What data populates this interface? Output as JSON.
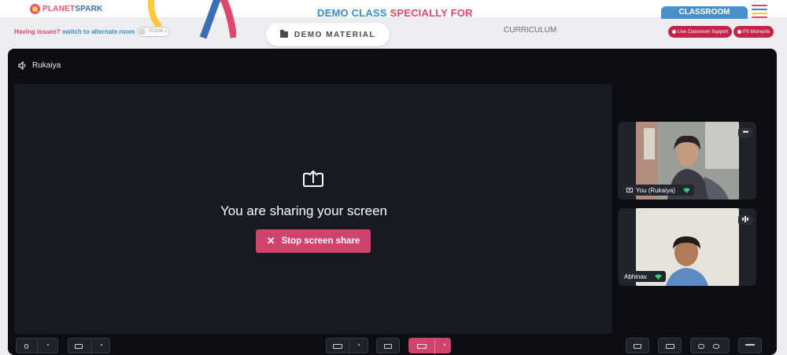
{
  "header": {
    "logo": {
      "text_a": "PLANET",
      "text_b": "SPARK"
    },
    "title_part1": "DEMO CLASS ",
    "title_part2": "SPECIALLY FOR",
    "classroom_tab": "CLASSROOM",
    "hamburger_colors": [
      "#e0476a",
      "#3a8ec8",
      "#ffc93c",
      "#e0476a"
    ]
  },
  "subbar": {
    "issues_label": "Having issues?",
    "alternate_room": "switch to alternate room",
    "room_toggle": "ROOM 1",
    "demo_material": "DEMO MATERIAL",
    "curriculum": "CURRICULUM",
    "live_support": "Live Classroom Support",
    "ps_moments": "PS Moments"
  },
  "stage": {
    "active_speaker": "Rukaiya",
    "share_message": "You are sharing your screen",
    "stop_share": "Stop screen share"
  },
  "participants": [
    {
      "name": "You (Rukaiya)",
      "icon": "screen-share-icon"
    },
    {
      "name": "Abhinav",
      "icon": "signal-icon"
    }
  ],
  "colors": {
    "accent_pink": "#d0436a",
    "accent_blue": "#3a8ec8",
    "stage_bg": "#0c0e14",
    "wifi_green": "#2ecc71"
  }
}
